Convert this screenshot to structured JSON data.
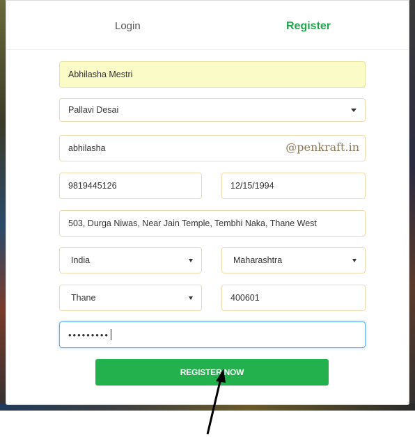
{
  "tabs": {
    "login": "Login",
    "register": "Register"
  },
  "form": {
    "full_name": "Abhilasha Mestri",
    "referred_by": "Pallavi Desai",
    "username": "abhilasha",
    "username_suffix": "@penkraft.in",
    "mobile": "9819445126",
    "dob": "12/15/1994",
    "address": "503, Durga Niwas, Near Jain Temple, Tembhi Naka, Thane West",
    "country": "India",
    "state": "Maharashtra",
    "city": "Thane",
    "pincode": "400601",
    "password_masked": "•••••••••"
  },
  "submit_label": "REGISTER NOW",
  "colors": {
    "accent_green": "#22b14c",
    "field_border": "#f0d9b0",
    "autofill_yellow": "#fbfbc7"
  }
}
